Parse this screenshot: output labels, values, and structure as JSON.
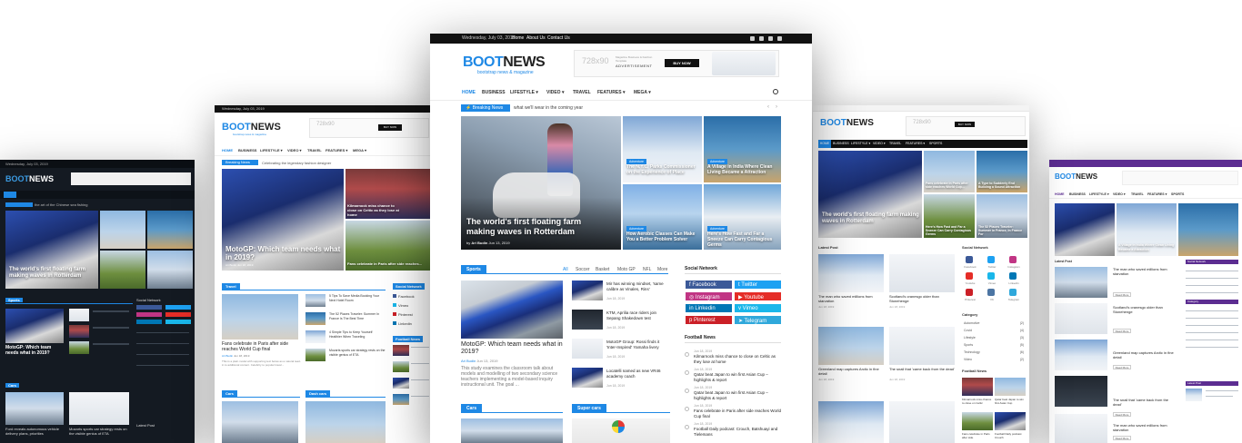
{
  "main": {
    "topbar": {
      "date": "Wednesday, July 03, 2019",
      "links": [
        "Home",
        "About Us",
        "Contact Us"
      ]
    },
    "logo": {
      "brand_a": "BOOT",
      "brand_b": "NEWS",
      "tagline": "bootstrap news & magazine"
    },
    "ad": {
      "size": "728x90",
      "small": "Magazine Business & Fashion Template",
      "label": "ADVERTISEMENT",
      "button": "BUY NOW"
    },
    "nav": [
      {
        "label": "HOME",
        "active": true
      },
      {
        "label": "BUSINESS"
      },
      {
        "label": "LIFESTYLE ▾"
      },
      {
        "label": "VIDEO ▾"
      },
      {
        "label": "TRAVEL"
      },
      {
        "label": "FEATURES ▾"
      },
      {
        "label": "MEGA ▾"
      }
    ],
    "breaking": {
      "label": "Breaking News",
      "text": "what we'll wear in the coming year"
    },
    "hero": {
      "big": {
        "title": "The world's first floating farm making waves in Rotterdam",
        "author": "Ari Budin",
        "date": "Jun 13, 2019"
      },
      "tiles": [
        {
          "tag": "Adventure",
          "title": "The N.Y.C. Parks Commissioner on the Experience of Place"
        },
        {
          "tag": "Adventure",
          "title": "A Village in India Where Clean Living Became a Attraction"
        },
        {
          "tag": "Adventure",
          "title": "How Aerobic Classes Can Make You a Better Problem Solver"
        },
        {
          "tag": "Adventure",
          "title": "Here's How Fast and Far a Sneeze Can Carry Contagious Germs"
        }
      ]
    },
    "sports": {
      "title": "Sports",
      "tabs": [
        "All",
        "Soccer",
        "Basket",
        "Moto GP",
        "NFL",
        "More"
      ],
      "lead": {
        "title": "MotoGP: Which team needs what in 2019?",
        "author": "Ari Budin",
        "date": "Jun 13, 2019",
        "excerpt": "This study examines the classroom talk about models and modelling of two secondary science teachers implementing a model-based inquiry instructional unit. The goal ..."
      },
      "list": [
        {
          "title": "Mir has winning mindset, 'same calibre as Vinales, Rins'",
          "date": "Jun 18, 2019"
        },
        {
          "title": "KTM, Aprilia race riders join Sepang Shakedown test",
          "date": "Jun 18, 2019"
        },
        {
          "title": "MotoGP Group: Rossi finds it 'Inter-Inspired' Yamaha livery",
          "date": "Jun 18, 2019"
        },
        {
          "title": "Locatelli named as new VR46 academy coach",
          "date": "Jun 18, 2019"
        }
      ]
    },
    "social": {
      "title": "Social Network",
      "items": [
        {
          "label": "Facebook",
          "color": "#3b5998"
        },
        {
          "label": "Twitter",
          "color": "#1da1f2"
        },
        {
          "label": "Instagram",
          "color": "#c13584"
        },
        {
          "label": "Youtube",
          "color": "#e52d27"
        },
        {
          "label": "Linkedin",
          "color": "#0077b5"
        },
        {
          "label": "Vimeo",
          "color": "#1ab7ea"
        },
        {
          "label": "Pinterest",
          "color": "#cb2027"
        },
        {
          "label": "Telegram",
          "color": "#2fa8db"
        }
      ]
    },
    "football": {
      "title": "Football News",
      "items": [
        {
          "date": "Jun 18, 2019",
          "title": "Kilmarnock miss chance to close on Celtic as they lose at home"
        },
        {
          "date": "Jun 18, 2019",
          "title": "Qatar beat Japan to win first Asian Cup – highlights & report"
        },
        {
          "date": "Jun 18, 2019",
          "title": "Qatar beat Japan to win first Asian Cup – highlights & report"
        },
        {
          "date": "Jun 18, 2019",
          "title": "Fans celebrate in Paris after side reaches World Cup final"
        },
        {
          "date": "Jun 18, 2019",
          "title": "Football Daily podcast: Crouch, Batshuayi and Tielemans"
        }
      ]
    },
    "bottom": {
      "cars": "Cars",
      "super_cars": "Super cars"
    }
  },
  "left2": {
    "topbar": {
      "date": "Wednesday, July 03, 2019",
      "links": [
        "Home",
        "About Us",
        "Contact Us"
      ]
    },
    "logo": {
      "brand_a": "BOOT",
      "brand_b": "NEWS",
      "tagline": "bootstrap news & magazine"
    },
    "ad": {
      "size": "728x90",
      "label": "ADVERTISEMENT",
      "button": "BUY NOW"
    },
    "nav": [
      "HOME",
      "BUSINESS",
      "LIFESTYLE ▾",
      "VIDEO ▾",
      "TRAVEL",
      "FEATURES ▾",
      "MEGA ▾"
    ],
    "breaking": {
      "label": "Breaking News",
      "text": "Celebrating the legendary fashion designer"
    },
    "hero": {
      "title": "MotoGP: Which team needs what in 2019?",
      "author": "Ari Budin",
      "date": "Jun 18, 2019"
    },
    "tiles": [
      "Kilmarnock miss chance to close on Celtic as they lose at home",
      "Fans celebrate in Paris after side reaches..."
    ],
    "travel": {
      "title": "Travel",
      "lead": {
        "title": "Fans celebrate in Paris after side reaches World Cup final",
        "author": "Ari Budin",
        "date": "Jun 18, 2019",
        "excerpt": "This is a plain model with supporting text below as a natural lead-in to additional content. Celebrity to popular travel..."
      },
      "list": [
        "5 Tips To Save Media Booking Your Next Hotel Room",
        "The 52 Places Traveler: Summer In France Is The Best Time",
        "4 Simple Tips to Keep Yourself Healthier When Traveling",
        "Mozarts sports car strategy rests on the visible genius of ETA"
      ]
    },
    "social": {
      "title": "Social Network",
      "items": [
        {
          "label": "Facebook",
          "color": "#3b5998"
        },
        {
          "label": "Vimeo",
          "color": "#1ab7ea"
        },
        {
          "label": "Pinterest",
          "color": "#cb2027"
        },
        {
          "label": "Linkedin",
          "color": "#0077b5"
        }
      ]
    },
    "football_title": "Football News",
    "bottom": {
      "cars": "Cars",
      "dash_cars": "Dash cars"
    }
  },
  "left1": {
    "topbar": {
      "date": "Wednesday, July 03, 2019",
      "links": [
        "Home",
        "About Us",
        "Contact Us"
      ]
    },
    "logo": {
      "brand_a": "BOOT",
      "brand_b": "NEWS"
    },
    "nav": [
      "HOME",
      "BUSINESS",
      "LIFESTYLE ▾",
      "VIDEO ▾",
      "TRAVEL",
      "FEATURES ▾",
      "MEGA ▾"
    ],
    "breaking": {
      "label": "Breaking News",
      "text": "the art of the Chinese sea fishing"
    },
    "hero": {
      "title": "The world's first floating farm making waves in Rotterdam",
      "tiles": [
        "The N.Y.C. Parks Commissioner on the Experience of Place",
        "A Village in India Where Clean Living Became a Attraction"
      ]
    },
    "sports_title": "Sports",
    "sports_tabs": [
      "All",
      "Soccer",
      "Basket",
      "Moto GP",
      "NFL",
      "More"
    ],
    "lead_title": "MotoGP: Which team needs what in 2019?",
    "cars_title": "Cars",
    "cars_items": [
      "Ford reveals autonomous vehicle delivery plans, priorities",
      "Mozarts sports car strategy rests on the visible genius of ETA"
    ],
    "social_title": "Social Network",
    "latest_title": "Latest Post"
  },
  "right1": {
    "logo": {
      "brand_a": "BOOT",
      "brand_b": "NEWS"
    },
    "ad": {
      "size": "728x90",
      "label": "ADVERTISEMENT",
      "button": "BUY NOW"
    },
    "nav": [
      "HOME",
      "BUSINESS",
      "LIFESTYLE ▾",
      "VIDEO ▾",
      "TRAVEL",
      "FEATURES ▾",
      "SPORTS"
    ],
    "hero": {
      "title": "The world's first floating farm making waves in Rotterdam",
      "tiles": [
        "Fans celebrate in Paris after side reaches World Cup...",
        "A Type to Suddenly End Building a Sound Attraction",
        "Here's How Fast and Far a Sneeze Can Carry Contagious Germs",
        "The 52 Places Traveler: Summer in France, In France For"
      ]
    },
    "latest_title": "Latest Post",
    "latest": [
      {
        "title": "The man who saved millions from starvation",
        "date": "Jun 18, 2019"
      },
      {
        "title": "Scotland's cranesgo older than Stonehenge",
        "date": "Jun 18, 2019"
      },
      {
        "title": "Greenland map captures Arctic in fine detail",
        "date": "Jun 18, 2019"
      },
      {
        "title": "The snail that 'came back from the dead'",
        "date": "Jun 18, 2019"
      }
    ],
    "social_title": "Social Network",
    "social": [
      "Facebook",
      "Twitter",
      "Instagram",
      "Youtube",
      "Vimeo",
      "Linkedin",
      "Pinterest",
      "VK",
      "Telegram"
    ],
    "category_title": "Category",
    "categories": [
      {
        "name": "Automotive",
        "count": "(2)"
      },
      {
        "name": "Covid",
        "count": "(4)"
      },
      {
        "name": "Lifestyle",
        "count": "(3)"
      },
      {
        "name": "Sports",
        "count": "(5)"
      },
      {
        "name": "Technology",
        "count": "(6)"
      },
      {
        "name": "Video",
        "count": "(2)"
      }
    ],
    "football_title": "Football News",
    "football": [
      "Kilmarnock miss chance to close on Celtic",
      "Qatar beat Japan to win first Asian Cup",
      "Fans celebrate in Paris after side",
      "Football Daily podcast Crouch"
    ]
  },
  "right2": {
    "logo": {
      "brand_a": "BOOT",
      "brand_b": "NEWS"
    },
    "nav": [
      "HOME",
      "BUSINESS",
      "LIFESTYLE ▾",
      "VIDEO ▾",
      "TRAVEL",
      "FEATURES ▾",
      "SPORTS"
    ],
    "hero": {
      "tiles": [
        "A Village in India Where Clean Living Became a Attraction"
      ]
    },
    "latest_title": "Latest Post",
    "latest": [
      {
        "title": "The man who saved millions from starvation",
        "button": "Read More"
      },
      {
        "title": "Scotland's cranesgo older than Stonehenge",
        "button": "Read More"
      },
      {
        "title": "Greenland map captures Arctic in fine detail",
        "button": "Read More"
      },
      {
        "title": "The snail that 'came back from the dead'",
        "button": "Read More"
      },
      {
        "title": "The man who saved millions from starvation",
        "button": "Read More"
      }
    ],
    "side_titles": [
      "Social Network",
      "Category",
      "Latest Post"
    ]
  }
}
